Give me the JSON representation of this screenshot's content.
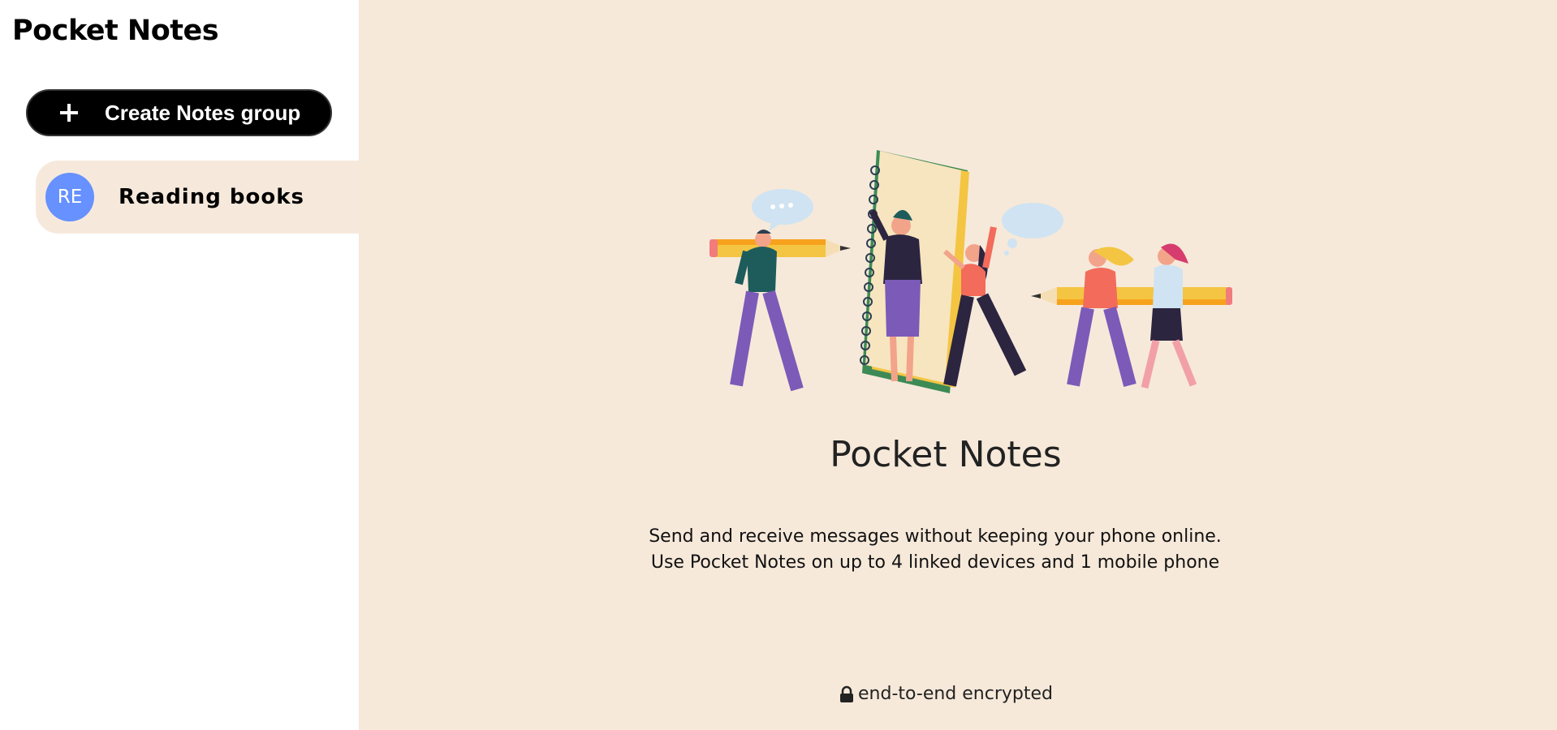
{
  "sidebar": {
    "title": "Pocket Notes",
    "create_button_label": "Create Notes group",
    "groups": [
      {
        "initials": "RE",
        "name": "Reading books",
        "color": "#6691ff"
      }
    ]
  },
  "main": {
    "title": "Pocket Notes",
    "description": "Send and receive messages without keeping your phone online. Use Pocket Notes on up to 4 linked devices and 1 mobile phone",
    "footer": "end-to-end encrypted",
    "illustration": "people-with-pencils-and-notebook"
  },
  "colors": {
    "main_background": "#f6e9da",
    "selected_group_background": "#f6e9dc",
    "button_background": "#000000",
    "avatar": "#6691ff"
  }
}
